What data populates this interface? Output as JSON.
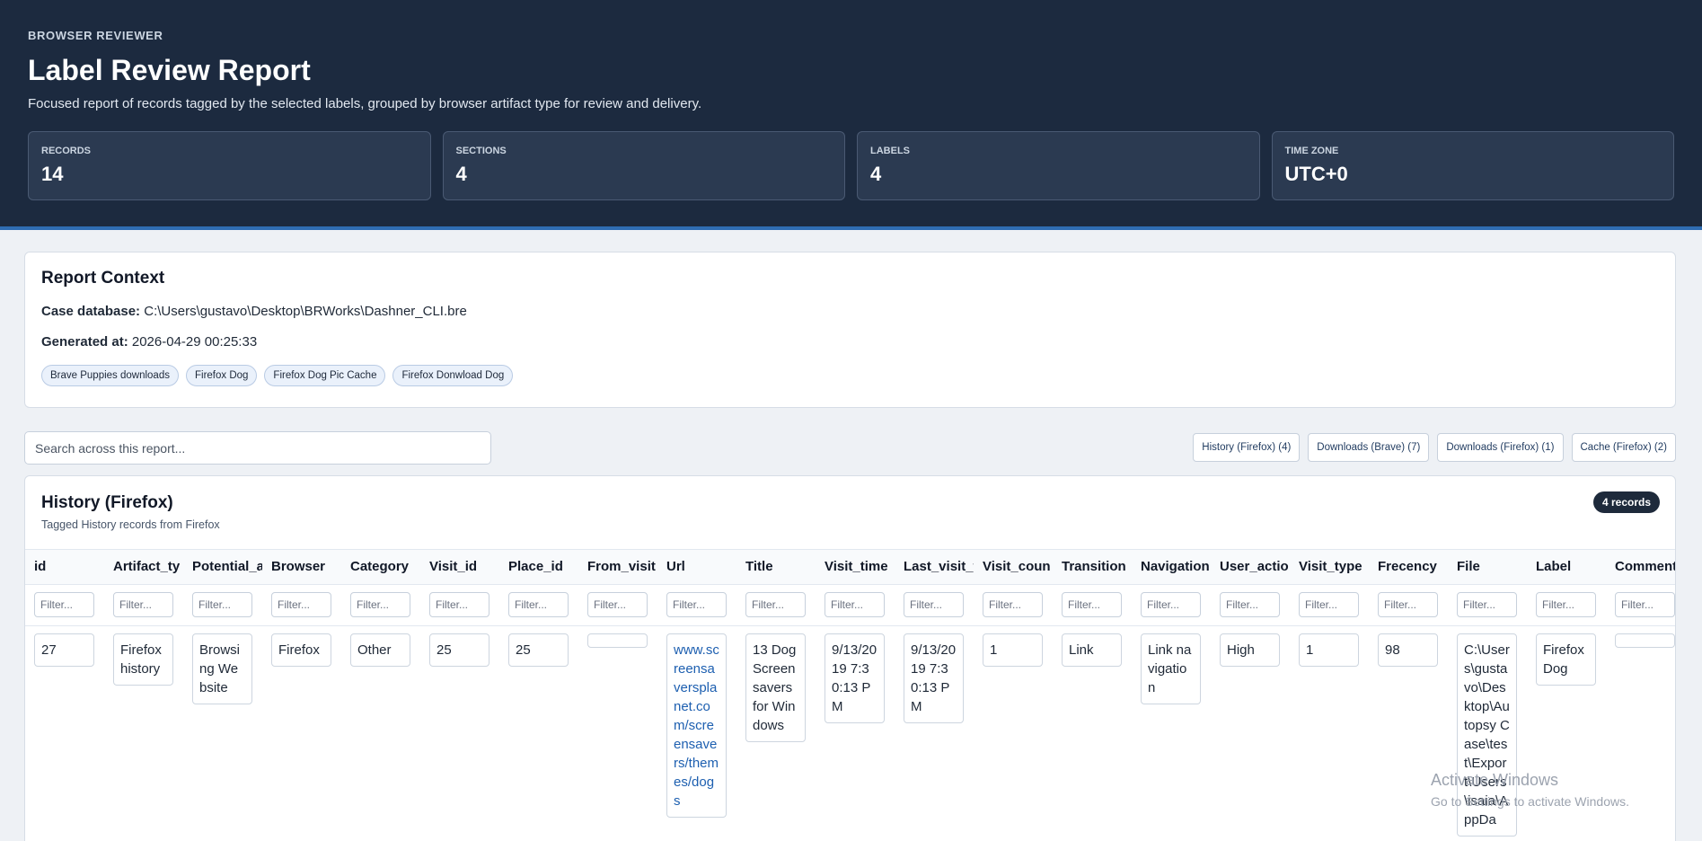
{
  "header": {
    "eyebrow": "BROWSER REVIEWER",
    "title": "Label Review Report",
    "subtitle": "Focused report of records tagged by the selected labels, grouped by browser artifact type for review and delivery."
  },
  "stats": [
    {
      "label": "RECORDS",
      "value": "14"
    },
    {
      "label": "SECTIONS",
      "value": "4"
    },
    {
      "label": "LABELS",
      "value": "4"
    },
    {
      "label": "TIME ZONE",
      "value": "UTC+0"
    }
  ],
  "context": {
    "title": "Report Context",
    "case_db_label": "Case database:",
    "case_db_value": "C:\\Users\\gustavo\\Desktop\\BRWorks\\Dashner_CLI.bre",
    "generated_label": "Generated at:",
    "generated_value": "2026-04-29 00:25:33",
    "labels": [
      "Brave Puppies downloads",
      "Firefox Dog",
      "Firefox Dog Pic Cache",
      "Firefox Donwload Dog"
    ]
  },
  "search": {
    "placeholder": "Search across this report..."
  },
  "jump_links": [
    "History (Firefox) (4)",
    "Downloads (Brave) (7)",
    "Downloads (Firefox) (1)",
    "Cache (Firefox) (2)"
  ],
  "section": {
    "title": "History (Firefox)",
    "subtitle": "Tagged History records from Firefox",
    "count": "4 records",
    "filter_placeholder": "Filter...",
    "columns": [
      "id",
      "Artifact_ty",
      "Potential_a",
      "Browser",
      "Category",
      "Visit_id",
      "Place_id",
      "From_visit",
      "Url",
      "Title",
      "Visit_time",
      "Last_visit_t",
      "Visit_coun",
      "Transition",
      "Navigation",
      "User_actio",
      "Visit_type",
      "Frecency",
      "File",
      "Label",
      "Comment"
    ],
    "rows": [
      [
        "27",
        "Firefox history",
        "Browsing Website",
        "Firefox",
        "Other",
        "25",
        "25",
        "",
        "www.screensaversplanet.com/screensavers/themes/dogs",
        "13 Dog Screen savers for Windows",
        "9/13/2019 7:30:13 PM",
        "9/13/2019 7:30:13 PM",
        "1",
        "Link",
        "Link navigation",
        "High",
        "1",
        "98",
        "C:\\Users\\gustavo\\Desktop\\Autopsy Case\\test\\Export\\Users\\isaia\\AppDa",
        "Firefox Dog",
        ""
      ]
    ]
  },
  "watermark": {
    "title": "Activate Windows",
    "subtitle": "Go to Settings to activate Windows."
  }
}
